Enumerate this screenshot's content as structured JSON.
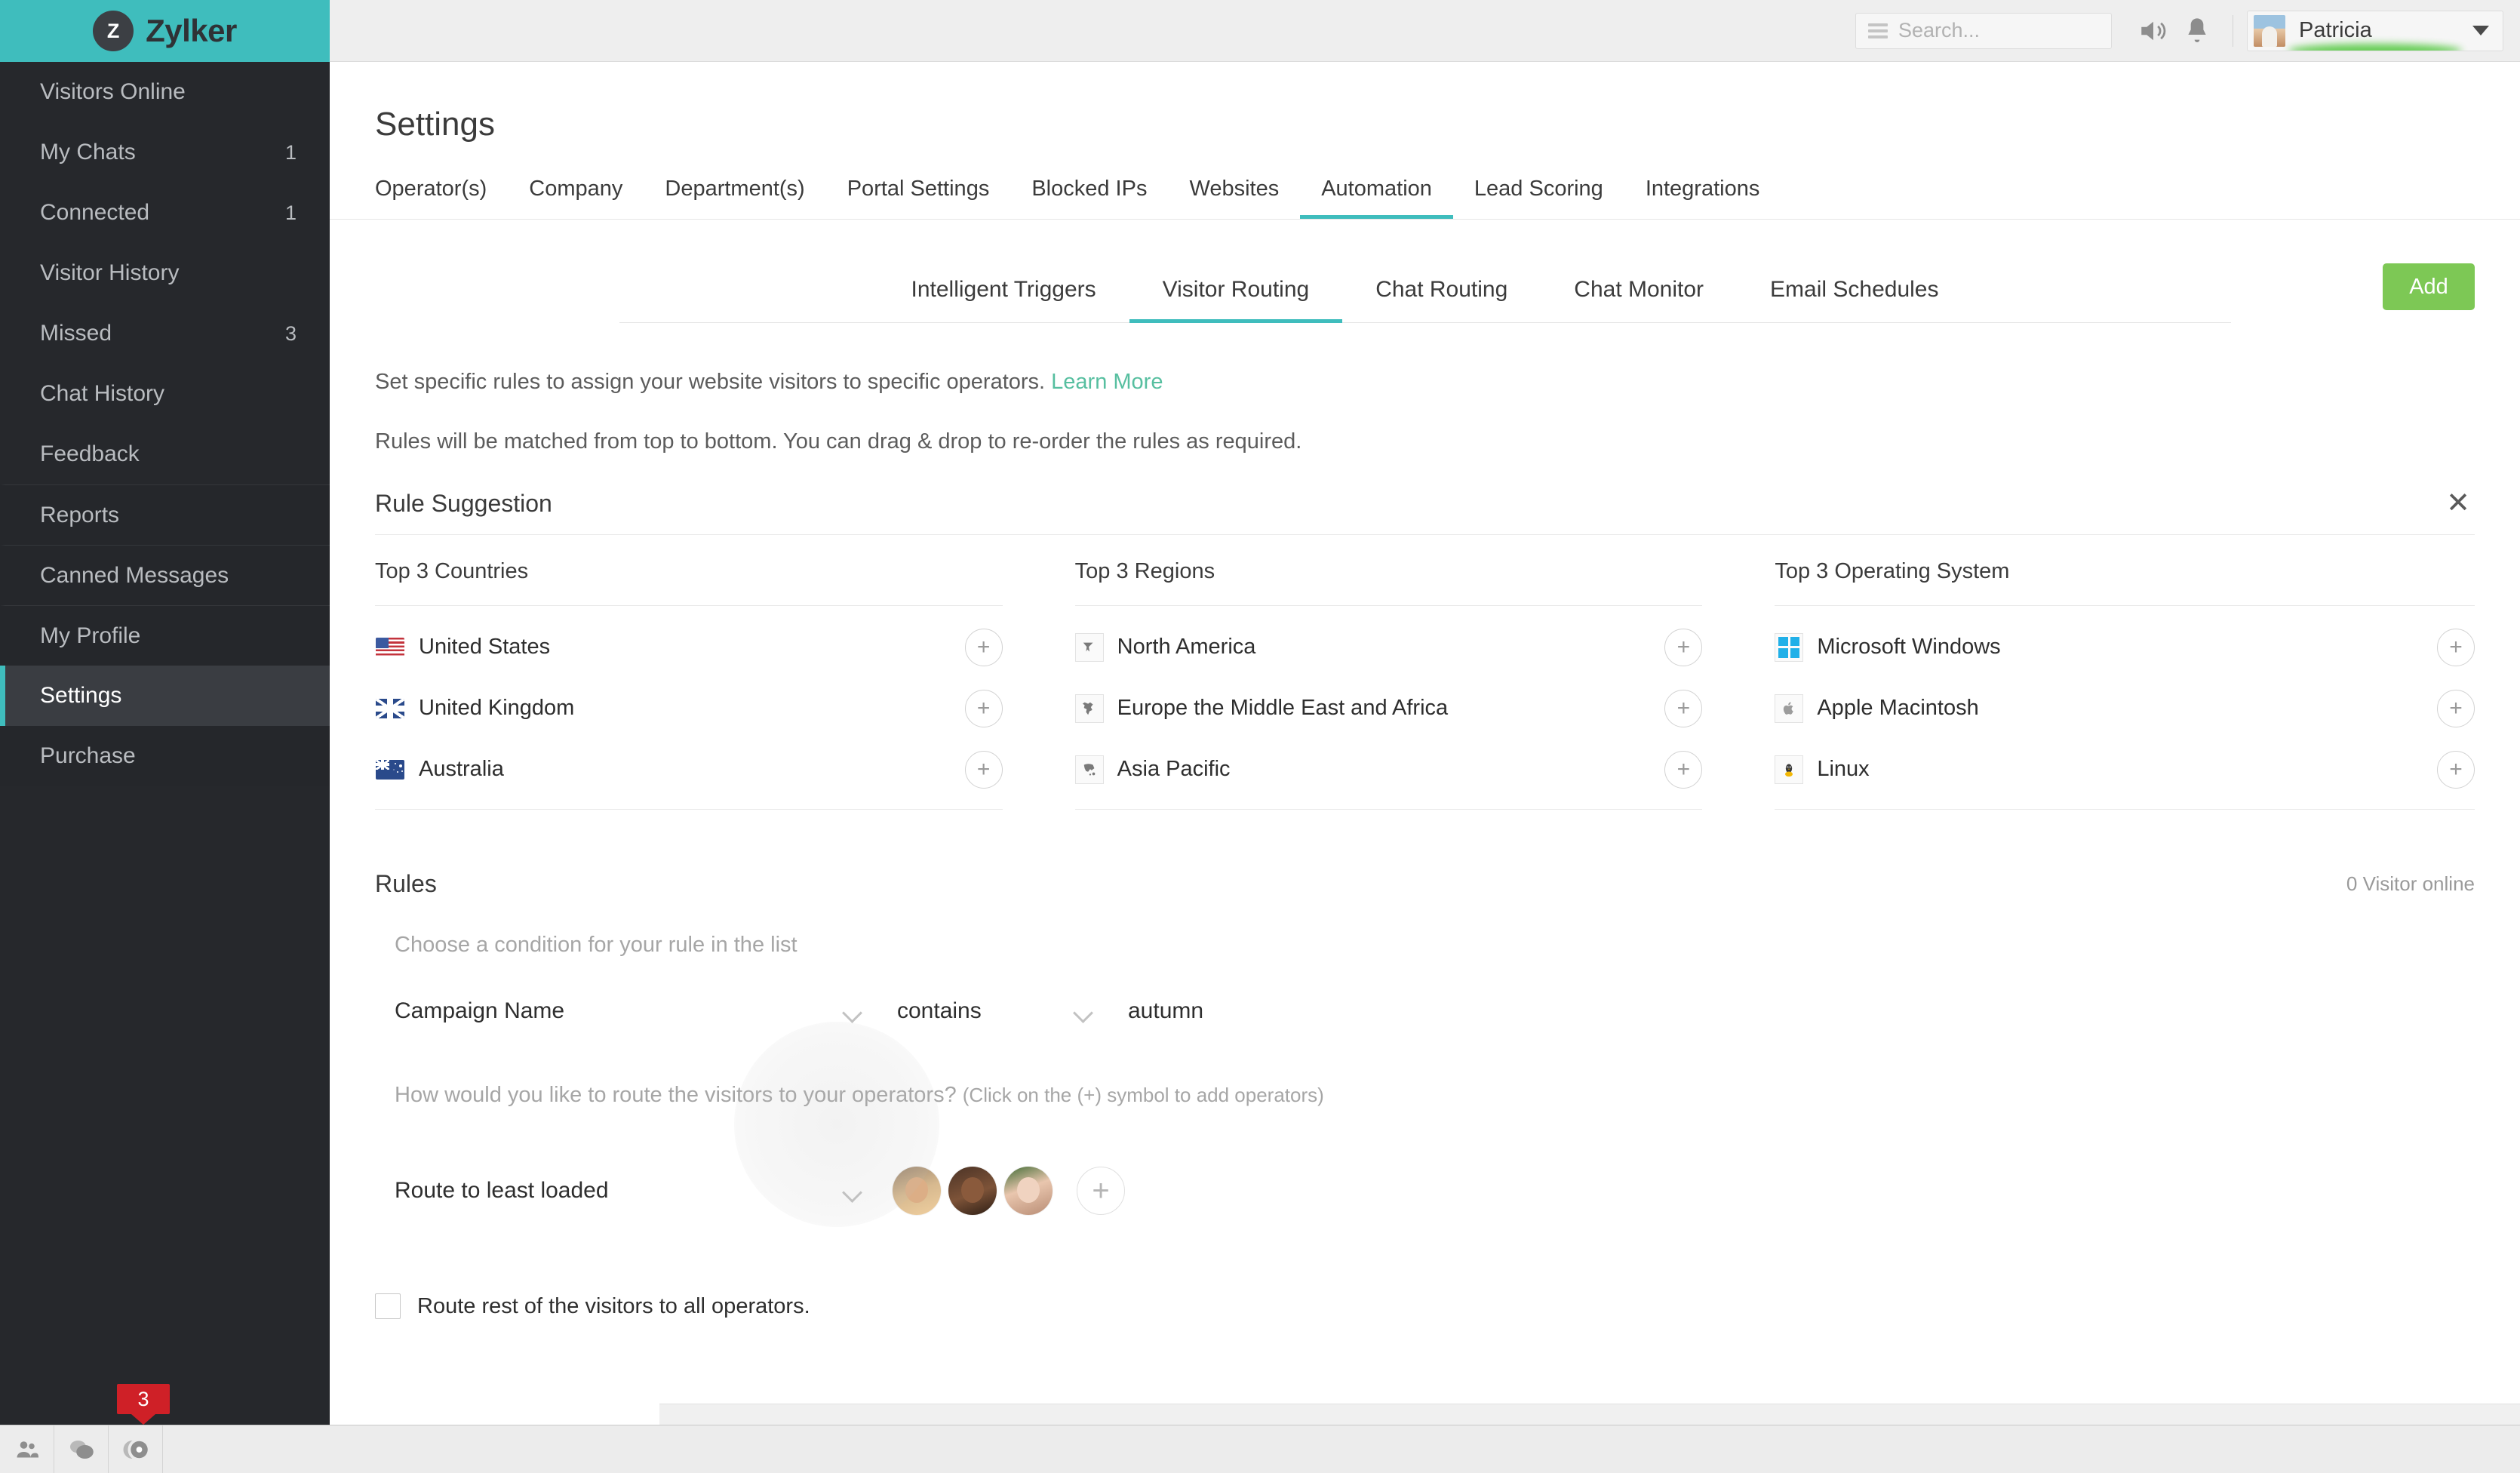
{
  "brand": {
    "logo_letter": "Z",
    "name": "Zylker"
  },
  "sidebar": {
    "items": [
      {
        "label": "Visitors Online",
        "badge": ""
      },
      {
        "label": "My Chats",
        "badge": "1"
      },
      {
        "label": "Connected",
        "badge": "1"
      },
      {
        "label": "Visitor History",
        "badge": ""
      },
      {
        "label": "Missed",
        "badge": "3"
      },
      {
        "label": "Chat History",
        "badge": ""
      },
      {
        "label": "Feedback",
        "badge": ""
      },
      {
        "label": "Reports",
        "badge": ""
      },
      {
        "label": "Canned Messages",
        "badge": ""
      },
      {
        "label": "My Profile",
        "badge": ""
      },
      {
        "label": "Settings",
        "badge": ""
      },
      {
        "label": "Purchase",
        "badge": ""
      }
    ],
    "active_item": "Settings"
  },
  "taskbar": {
    "badge_count": "3",
    "icons": [
      "visitors-icon",
      "chats-icon",
      "monitor-icon"
    ]
  },
  "topbar": {
    "search_placeholder": "Search...",
    "user_name": "Patricia",
    "icons": [
      "menu-icon",
      "speaker-icon",
      "bell-icon",
      "chevron-down-icon"
    ]
  },
  "page": {
    "title": "Settings"
  },
  "tabs": [
    {
      "label": "Operator(s)",
      "active": false
    },
    {
      "label": "Company",
      "active": false
    },
    {
      "label": "Department(s)",
      "active": false
    },
    {
      "label": "Portal Settings",
      "active": false
    },
    {
      "label": "Blocked IPs",
      "active": false
    },
    {
      "label": "Websites",
      "active": false
    },
    {
      "label": "Automation",
      "active": true
    },
    {
      "label": "Lead Scoring",
      "active": false
    },
    {
      "label": "Integrations",
      "active": false
    }
  ],
  "subtabs": [
    {
      "label": "Intelligent Triggers",
      "active": false
    },
    {
      "label": "Visitor Routing",
      "active": true
    },
    {
      "label": "Chat Routing",
      "active": false
    },
    {
      "label": "Chat Monitor",
      "active": false
    },
    {
      "label": "Email Schedules",
      "active": false
    }
  ],
  "add_button": {
    "label": "Add",
    "color": "#7dc855"
  },
  "description": {
    "line1": "Set specific rules to assign your website visitors to specific operators.",
    "learn_more": "Learn More",
    "line2": "Rules will be matched from top to bottom. You can drag & drop to re-order the rules as required."
  },
  "rule_suggestion": {
    "title": "Rule Suggestion",
    "close_label": "✕",
    "columns": [
      {
        "header": "Top 3 Countries",
        "rows": [
          {
            "name": "United States",
            "icon": "flag-us-icon",
            "action": "+"
          },
          {
            "name": "United Kingdom",
            "icon": "flag-uk-icon",
            "action": "+"
          },
          {
            "name": "Australia",
            "icon": "flag-au-icon",
            "action": "+"
          }
        ]
      },
      {
        "header": "Top 3 Regions",
        "rows": [
          {
            "name": "North America",
            "icon": "map-north-america-icon",
            "action": "+"
          },
          {
            "name": "Europe the Middle East and Africa",
            "icon": "map-emea-icon",
            "action": "+"
          },
          {
            "name": "Asia Pacific",
            "icon": "map-apac-icon",
            "action": "+"
          }
        ]
      },
      {
        "header": "Top 3 Operating System",
        "rows": [
          {
            "name": "Microsoft Windows",
            "icon": "windows-icon",
            "action": "+"
          },
          {
            "name": "Apple Macintosh",
            "icon": "apple-icon",
            "action": "+"
          },
          {
            "name": "Linux",
            "icon": "linux-icon",
            "action": "+"
          }
        ]
      }
    ]
  },
  "rules": {
    "title": "Rules",
    "visitor_online": "0 Visitor online",
    "condition_hint": "Choose a condition for your rule in the list",
    "condition_field": "Campaign Name",
    "condition_operator": "contains",
    "condition_value": "autumn",
    "route_hint_main": "How would you like to route the visitors to your operators?",
    "route_hint_sub": "(Click on the (+) symbol to add operators)",
    "route_mode": "Route to least loaded",
    "operators": [
      "operator-avatar-1",
      "operator-avatar-2",
      "operator-avatar-3"
    ],
    "add_operator_label": "+",
    "checkbox_label": "Route rest of the visitors to all operators.",
    "checkbox_checked": false
  },
  "colors": {
    "brand_teal": "#3fbdbd",
    "sidebar_dark": "#26282c",
    "accent_green": "#7dc855",
    "link_green": "#57bfa0",
    "badge_red": "#cf2027"
  }
}
